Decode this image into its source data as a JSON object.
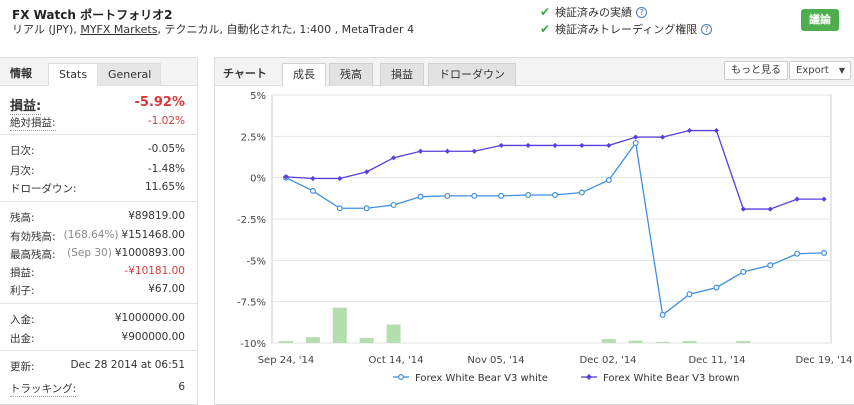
{
  "header": {
    "title": "FX Watch ポートフォリオ2",
    "sub_prefix": "リアル (JPY), ",
    "sub_link": "MYFX Markets",
    "sub_suffix": ", テクニカル, 自動化された, 1:400 , MetaTrader 4",
    "verify1": "検証済みの実績",
    "verify2": "検証済みトレーディング権限",
    "discuss_button": "議論"
  },
  "sidebar": {
    "tabs": {
      "info": "情報",
      "stats": "Stats",
      "general": "General"
    },
    "gain_label": "損益:",
    "gain_value": "-5.92%",
    "abs_gain_label": "絶対損益:",
    "abs_gain_value": "-1.02%",
    "daily_label": "日次:",
    "daily_value": "-0.05%",
    "monthly_label": "月次:",
    "monthly_value": "-1.48%",
    "drawdown_label": "ドローダウン:",
    "drawdown_value": "11.65%",
    "balance_label": "残高:",
    "balance_value": "¥89819.00",
    "equity_label": "有効残高:",
    "equity_note": "(168.64%)",
    "equity_value": "¥151468.00",
    "highest_label": "最高残高:",
    "highest_note": "(Sep 30)",
    "highest_value": "¥1000893.00",
    "profit_label": "損益:",
    "profit_value": "-¥10181.00",
    "interest_label": "利子:",
    "interest_value": "¥67.00",
    "deposits_label": "入金:",
    "deposits_value": "¥1000000.00",
    "withdrawals_label": "出金:",
    "withdrawals_value": "¥900000.00",
    "updated_label": "更新:",
    "updated_value": "Dec 28 2014 at 06:51",
    "tracking_label": "トラッキング:",
    "tracking_value": "6"
  },
  "chart_panel": {
    "label": "チャート",
    "tabs": [
      "成長",
      "残高",
      "損益",
      "ドローダウン"
    ],
    "more_button": "もっと見る",
    "export_button": "Export"
  },
  "chart_data": {
    "type": "line",
    "y_ticks": [
      "5%",
      "2.5%",
      "0%",
      "-2.5%",
      "-5%",
      "-7.5%",
      "-10%"
    ],
    "ylim": [
      -10,
      5
    ],
    "x_ticks": [
      "Sep 24, '14",
      "Oct 14, '14",
      "Nov 05, '14",
      "Dec 02, '14",
      "Dec 11, '14",
      "Dec 19, '14"
    ],
    "grid": true,
    "legend_position": "bottom",
    "series": [
      {
        "name": "Forex White Bear V3  white",
        "color": "#3f8fe0",
        "values": [
          0,
          -0.8,
          -1.85,
          -1.85,
          -1.65,
          -1.15,
          -1.1,
          -1.1,
          -1.1,
          -1.05,
          -1.05,
          -0.9,
          -0.15,
          2.1,
          -8.3,
          -7.05,
          -6.65,
          -5.7,
          -5.3,
          -4.6,
          -4.55
        ]
      },
      {
        "name": "Forex White Bear V3  brown",
        "color": "#5a3fe0",
        "values": [
          0.05,
          -0.05,
          -0.05,
          0.35,
          1.2,
          1.6,
          1.6,
          1.6,
          1.95,
          1.95,
          1.95,
          1.95,
          1.95,
          2.45,
          2.45,
          2.85,
          2.85,
          -1.9,
          -1.9,
          -1.3,
          -1.3
        ]
      }
    ],
    "volume_bars": [
      0.5,
      1.5,
      9,
      1.3,
      4.7,
      0,
      0,
      0,
      0,
      0,
      0,
      0,
      1,
      0.6,
      0.3,
      0.5,
      0,
      0.5,
      0,
      0,
      0
    ]
  }
}
